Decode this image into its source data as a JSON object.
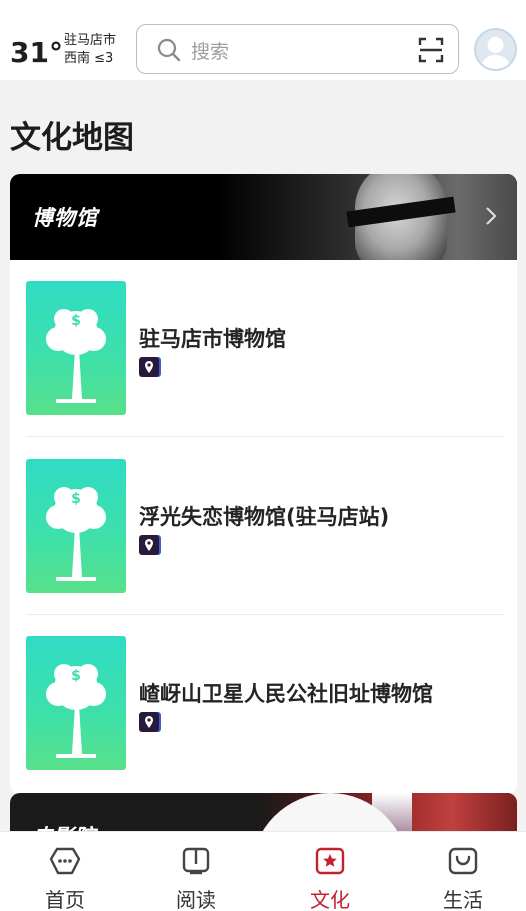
{
  "weather": {
    "temperature": "31°",
    "city": "驻马店市",
    "wind": "西南 ≤3"
  },
  "search": {
    "placeholder": "搜索"
  },
  "page_title": "文化地图",
  "museum_section": {
    "label": "博物馆",
    "items": [
      {
        "name": "驻马店市博物馆"
      },
      {
        "name": "浮光失恋博物馆(驻马店站)"
      },
      {
        "name": "嵖岈山卫星人民公社旧址博物馆"
      }
    ]
  },
  "cinema_section": {
    "label": "电影院"
  },
  "tabs": [
    {
      "label": "首页",
      "icon": "home-icon",
      "active": false
    },
    {
      "label": "阅读",
      "icon": "book-icon",
      "active": false
    },
    {
      "label": "文化",
      "icon": "culture-star-icon",
      "active": true
    },
    {
      "label": "生活",
      "icon": "shopping-bag-icon",
      "active": false
    }
  ],
  "colors": {
    "accent": "#c4212f",
    "thumb_top": "#2fdcc4",
    "thumb_bottom": "#58e08a"
  }
}
